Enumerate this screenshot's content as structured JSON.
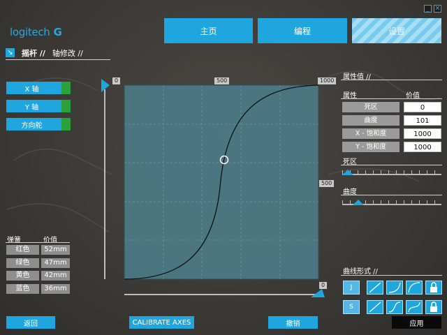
{
  "brand": {
    "logo_text": "logitech",
    "logo_mark": "G"
  },
  "window": {
    "minimize_glyph": "_",
    "close_glyph": "✕"
  },
  "tabs": [
    {
      "label": "主页"
    },
    {
      "label": "编程"
    },
    {
      "label": "设置"
    }
  ],
  "breadcrumb": {
    "arrow": "↘",
    "level1": "摇杆 //",
    "level2": "轴修改 //"
  },
  "axes": [
    {
      "label": "X 轴"
    },
    {
      "label": "Y 轴"
    },
    {
      "label": "方向舵"
    }
  ],
  "springs": {
    "header_color": "弹簧",
    "header_value": "价值",
    "rows": [
      {
        "color": "红色",
        "value": "52mm"
      },
      {
        "color": "绿色",
        "value": "47mm"
      },
      {
        "color": "黄色",
        "value": "42mm"
      },
      {
        "color": "蓝色",
        "value": "36mm"
      }
    ]
  },
  "plot": {
    "x_ticks": [
      "0",
      "500",
      "1000"
    ],
    "y_ticks": [
      "1000",
      "500",
      "0"
    ]
  },
  "properties": {
    "title": "属性值 //",
    "header_prop": "属性",
    "header_value": "价值",
    "rows": [
      {
        "label": "死区",
        "value": "0"
      },
      {
        "label": "曲度",
        "value": "101"
      },
      {
        "label": "X - 饱和度",
        "value": "1000"
      },
      {
        "label": "Y - 饱和度",
        "value": "1000"
      }
    ],
    "deadzone_label": "死区",
    "curvature_label": "曲度"
  },
  "curve_shape": {
    "title": "曲线形式 //",
    "row1_letter": "J",
    "row2_letter": "S"
  },
  "bottom": {
    "back": "返回",
    "calibrate": "CALIBRATE AXES",
    "undo": "撤销",
    "apply": "应用"
  },
  "colors": {
    "accent": "#1fa6df",
    "indicator": "#2aa13a",
    "plot_bg": "#4f7f8c"
  }
}
